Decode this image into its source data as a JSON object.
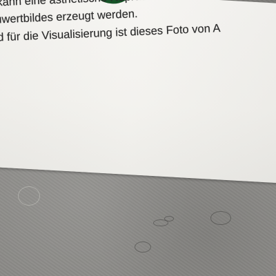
{
  "text_lines": [
    "",
    "nzen kann eine ästhetische Repräsentation eines",
    "gsgrauwertbildes erzeugt werden.",
    "ngsbild für die Visualisierung ist dieses Foto von A",
    "."
  ],
  "colors": {
    "paper": "#f3f2ee",
    "ink": "#2a2a2a",
    "surface": "#8a8986",
    "green_mark": "#1f6a33"
  }
}
